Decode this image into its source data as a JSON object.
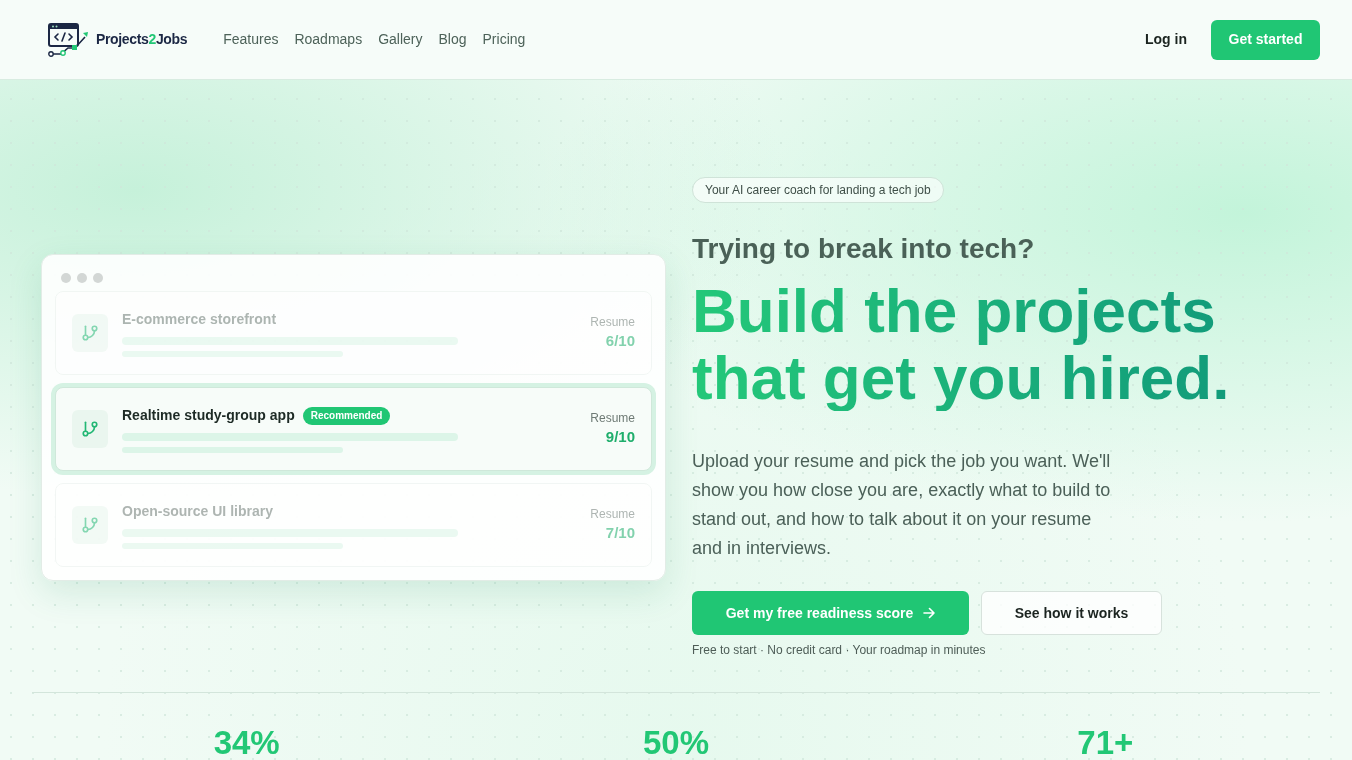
{
  "header": {
    "brand": {
      "parts": [
        {
          "text": "Projects",
          "accent": false
        },
        {
          "text": "2",
          "accent": true
        },
        {
          "text": "Jobs",
          "accent": false
        }
      ]
    },
    "nav": [
      {
        "label": "Features"
      },
      {
        "label": "Roadmaps"
      },
      {
        "label": "Gallery"
      },
      {
        "label": "Blog"
      },
      {
        "label": "Pricing"
      }
    ],
    "login": "Log in",
    "cta": "Get started"
  },
  "preview": {
    "projects": [
      {
        "title": "E-commerce storefront",
        "highlighted": false,
        "score_label": "Resume",
        "score": "6/10"
      },
      {
        "title": "Realtime study-group app",
        "highlighted": true,
        "badge": "Recommended",
        "score_label": "Resume",
        "score": "9/10"
      },
      {
        "title": "Open-source UI library",
        "highlighted": false,
        "score_label": "Resume",
        "score": "7/10"
      }
    ]
  },
  "hero": {
    "badge": "Your AI career coach for landing a tech job",
    "kicker": "Trying to break into tech?",
    "headline": "Build the projects that get you hired.",
    "description": "Upload your resume and pick the job you want. We'll show you how close you are, exactly what to build to stand out, and how to talk about it on your resume and in interviews.",
    "primary_button": "Get my free readiness score",
    "secondary_button": "See how it works",
    "note": "Free to start · No credit card · Your roadmap in minutes"
  },
  "stats": [
    {
      "value": "34%"
    },
    {
      "value": "50%"
    },
    {
      "value": "71+"
    }
  ]
}
